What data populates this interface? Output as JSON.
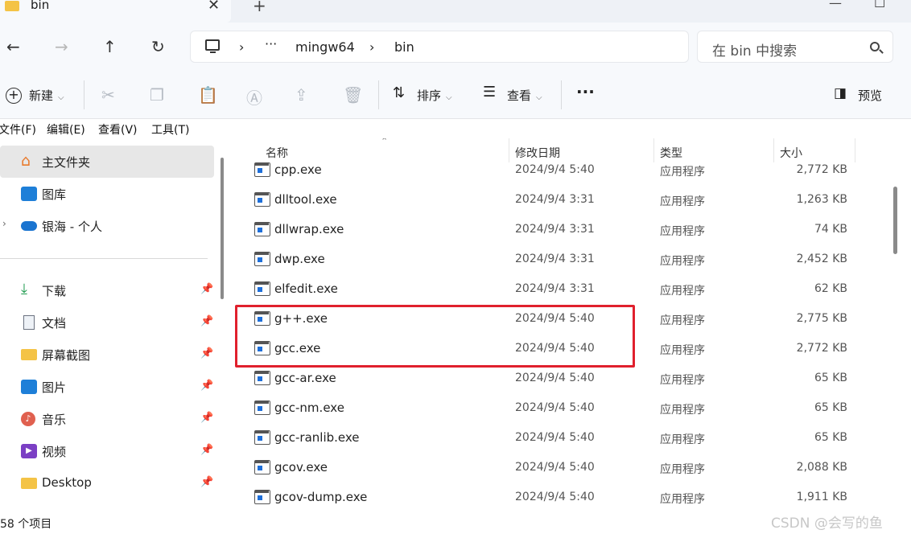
{
  "tab": {
    "title": "bin",
    "close_glyph": "✕",
    "new_tab_glyph": "+"
  },
  "window_controls": [
    "—",
    "☐"
  ],
  "nav": {
    "back": "←",
    "forward": "→",
    "up": "↑",
    "refresh": "↻"
  },
  "address": {
    "separator": "›",
    "overflow": "···",
    "crumbs": [
      "mingw64",
      "bin"
    ]
  },
  "search": {
    "placeholder": "在 bin 中搜索"
  },
  "toolbar": {
    "new_label": "新建",
    "sort_label": "排序",
    "view_label": "查看",
    "more_glyph": "···",
    "preview_label": "预览",
    "icons": [
      "cut-icon",
      "copy-icon",
      "paste-icon",
      "rename-icon",
      "share-icon",
      "delete-icon"
    ]
  },
  "menubar": [
    "文件(F)",
    "编辑(E)",
    "查看(V)",
    "工具(T)"
  ],
  "sidebar": {
    "home": "主文件夹",
    "gallery": "图库",
    "onedrive": "银海 - 个人",
    "quick": [
      "下载",
      "文档",
      "屏幕截图",
      "图片",
      "音乐",
      "视频",
      "Desktop"
    ],
    "pin_glyph": "📌"
  },
  "columns": {
    "name": "名称",
    "date": "修改日期",
    "type": "类型",
    "size": "大小"
  },
  "files": [
    {
      "name": "cpp.exe",
      "date": "2024/9/4 5:40",
      "type": "应用程序",
      "size": "2,772 KB"
    },
    {
      "name": "dlltool.exe",
      "date": "2024/9/4 3:31",
      "type": "应用程序",
      "size": "1,263 KB"
    },
    {
      "name": "dllwrap.exe",
      "date": "2024/9/4 3:31",
      "type": "应用程序",
      "size": "74 KB"
    },
    {
      "name": "dwp.exe",
      "date": "2024/9/4 3:31",
      "type": "应用程序",
      "size": "2,452 KB"
    },
    {
      "name": "elfedit.exe",
      "date": "2024/9/4 3:31",
      "type": "应用程序",
      "size": "62 KB"
    },
    {
      "name": "g++.exe",
      "date": "2024/9/4 5:40",
      "type": "应用程序",
      "size": "2,775 KB"
    },
    {
      "name": "gcc.exe",
      "date": "2024/9/4 5:40",
      "type": "应用程序",
      "size": "2,772 KB"
    },
    {
      "name": "gcc-ar.exe",
      "date": "2024/9/4 5:40",
      "type": "应用程序",
      "size": "65 KB"
    },
    {
      "name": "gcc-nm.exe",
      "date": "2024/9/4 5:40",
      "type": "应用程序",
      "size": "65 KB"
    },
    {
      "name": "gcc-ranlib.exe",
      "date": "2024/9/4 5:40",
      "type": "应用程序",
      "size": "65 KB"
    },
    {
      "name": "gcov.exe",
      "date": "2024/9/4 5:40",
      "type": "应用程序",
      "size": "2,088 KB"
    },
    {
      "name": "gcov-dump.exe",
      "date": "2024/9/4 5:40",
      "type": "应用程序",
      "size": "1,911 KB"
    }
  ],
  "status": {
    "count": "58 个项目"
  },
  "watermark": "CSDN @会写的鱼",
  "colors": {
    "highlight": "#e0202d",
    "folder": "#f4c346",
    "selected": "#e7e7e7"
  }
}
